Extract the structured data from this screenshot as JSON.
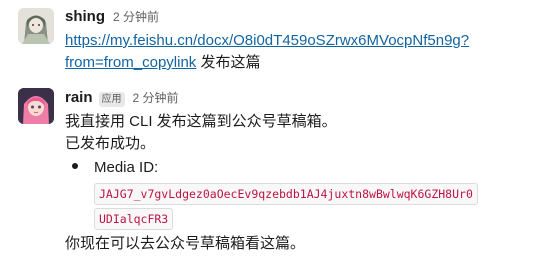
{
  "messages": [
    {
      "name": "shing",
      "time": "2 分钟前",
      "link_line1": "https://my.feishu.cn/docx/O8i0dT459oSZrwx6MVocpNf5n9g?",
      "link_line2": "from=from_copylink",
      "after_link": " 发布这篇"
    },
    {
      "name": "rain",
      "badge": "应用",
      "time": "2 分钟前",
      "line1": "我直接用 CLI 发布这篇到公众号草稿箱。",
      "line2": "已发布成功。",
      "bullet_label": "Media ID",
      "bullet_colon": ":",
      "code_line1": "JAJG7_v7gvLdgez0aOecEv9qzebdb1AJ4juxtn8wBwlwqK6GZH8Ur0",
      "code_line2": "UDIalqcFR3",
      "line3": "你现在可以去公众号草稿箱看这篇。"
    }
  ]
}
